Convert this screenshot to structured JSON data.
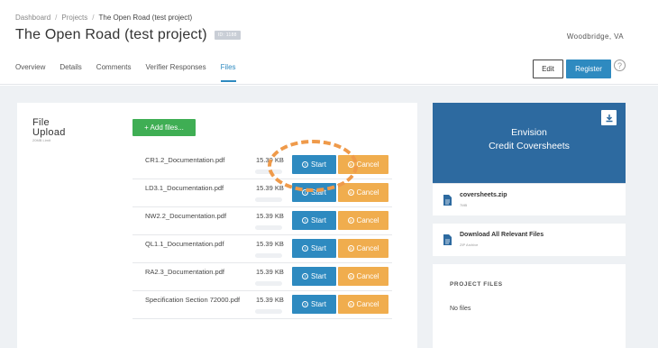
{
  "breadcrumb": {
    "items": [
      "Dashboard",
      "Projects",
      "The Open Road (test project)"
    ]
  },
  "header": {
    "title": "The Open Road (test project)",
    "tag": "ID: 1188",
    "location": "Woodbridge, VA",
    "edit_label": "Edit",
    "register_label": "Register",
    "help_label": "?"
  },
  "tabs": [
    {
      "label": "Overview",
      "active": false
    },
    {
      "label": "Details",
      "active": false
    },
    {
      "label": "Comments",
      "active": false
    },
    {
      "label": "Verifier Responses",
      "active": false
    },
    {
      "label": "Files",
      "active": true
    }
  ],
  "upload": {
    "title_line1": "File",
    "title_line2": "Upload",
    "subtitle": "20MB Limit",
    "add_label": "+ Add files...",
    "start_label": "Start",
    "cancel_label": "Cancel",
    "files": [
      {
        "name": "CR1.2_Documentation.pdf",
        "size": "15.39 KB",
        "progress": 0
      },
      {
        "name": "LD3.1_Documentation.pdf",
        "size": "15.39 KB",
        "progress": 0
      },
      {
        "name": "NW2.2_Documentation.pdf",
        "size": "15.39 KB",
        "progress": 0
      },
      {
        "name": "QL1.1_Documentation.pdf",
        "size": "15.39 KB",
        "progress": 0
      },
      {
        "name": "RA2.3_Documentation.pdf",
        "size": "15.39 KB",
        "progress": 0
      },
      {
        "name": "Specification Section 72000.pdf",
        "size": "15.39 KB",
        "progress": 0
      }
    ]
  },
  "envision": {
    "title_line1": "Envision",
    "title_line2": "Credit Coversheets"
  },
  "zip_file": {
    "name": "coversheets.zip",
    "size": "7MB"
  },
  "all_files": {
    "name": "Download All Relevant Files",
    "sub": "ZIP Archive"
  },
  "project_files": {
    "title": "PROJECT FILES",
    "empty": "No files"
  },
  "colors": {
    "primary": "#2e8ac0",
    "success": "#3fae54",
    "warning": "#f0ad4e",
    "envision": "#2d6aa0",
    "annotation": "#ef9a4a"
  }
}
